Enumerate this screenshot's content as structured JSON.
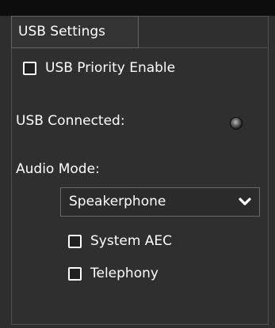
{
  "tab": {
    "label": "USB Settings"
  },
  "usb_priority": {
    "label": "USB Priority Enable",
    "checked": false
  },
  "usb_connected": {
    "label": "USB Connected:",
    "led_state": "off"
  },
  "audio_mode": {
    "label": "Audio Mode:",
    "selected": "Speakerphone"
  },
  "options": {
    "system_aec": {
      "label": "System AEC",
      "checked": false
    },
    "telephony": {
      "label": "Telephony",
      "checked": false
    }
  }
}
